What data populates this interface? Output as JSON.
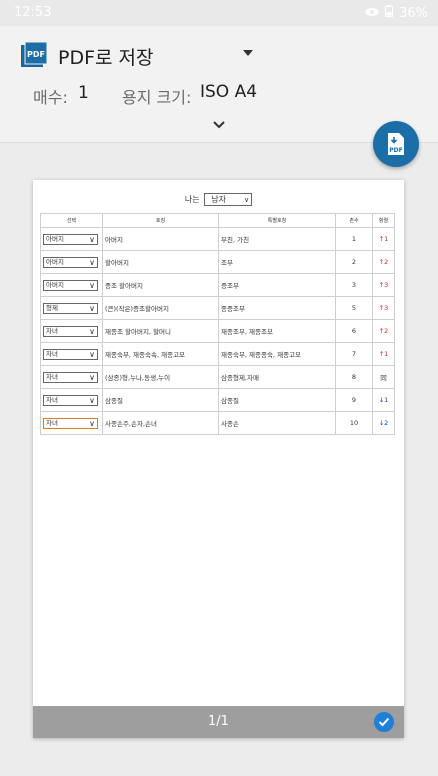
{
  "status": {
    "time": "12:53",
    "battery": "36%"
  },
  "header": {
    "destination": "PDF로 저장",
    "copies_label": "매수:",
    "copies_value": "1",
    "paper_label": "용지 크기:",
    "paper_value": "ISO A4"
  },
  "fab": {
    "label": "PDF"
  },
  "document": {
    "gender_label": "나는",
    "gender_value": "남자",
    "columns": [
      "선택",
      "호칭",
      "특별호칭",
      "촌수",
      "항렬"
    ],
    "rows": [
      {
        "sel": "아버지",
        "ho": "아버지",
        "sp": "부친, 가친",
        "chon": "1",
        "dir": "up",
        "hang": "1"
      },
      {
        "sel": "아버지",
        "ho": "할아버지",
        "sp": "조부",
        "chon": "2",
        "dir": "up",
        "hang": "2"
      },
      {
        "sel": "아버지",
        "ho": "증조 할아버지",
        "sp": "증조부",
        "chon": "3",
        "dir": "up",
        "hang": "3"
      },
      {
        "sel": "형제",
        "ho": "(큰)(작은)증조할아버지",
        "sp": "종증조부",
        "chon": "5",
        "dir": "up",
        "hang": "3"
      },
      {
        "sel": "자녀",
        "ho": "재종조 할아버지, 할머니",
        "sp": "재종조부, 재종조모",
        "chon": "6",
        "dir": "up",
        "hang": "2"
      },
      {
        "sel": "자녀",
        "ho": "재종숙부, 재종숙속, 재종고모",
        "sp": "재종숙부, 재종종숙, 재종고모",
        "chon": "7",
        "dir": "up",
        "hang": "1"
      },
      {
        "sel": "자녀",
        "ho": "(삼종)형,누나,동생,누이",
        "sp": "삼종형제,자매",
        "chon": "8",
        "dir": "same",
        "hang": "同"
      },
      {
        "sel": "자녀",
        "ho": "삼종질",
        "sp": "삼종질",
        "chon": "9",
        "dir": "down",
        "hang": "1"
      },
      {
        "sel": "자녀",
        "ho": "사종손주,손자,손녀",
        "sp": "사종손",
        "chon": "10",
        "dir": "down",
        "hang": "2"
      }
    ]
  },
  "pagebar": {
    "page": "1/1"
  }
}
